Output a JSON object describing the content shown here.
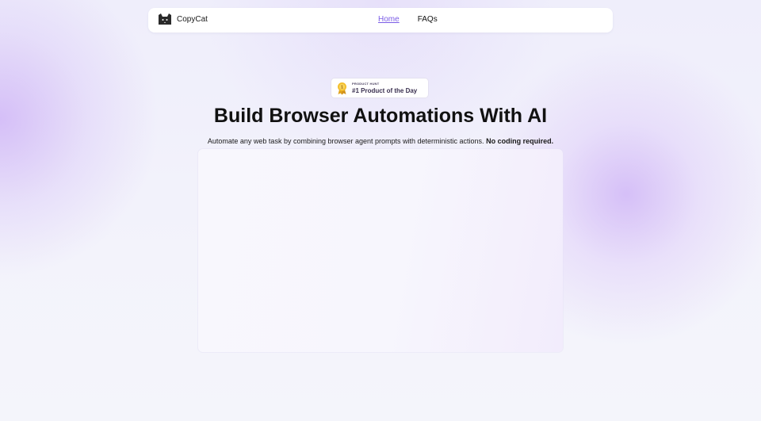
{
  "nav": {
    "brand": "CopyCat",
    "logo_icon": "cat-icon",
    "links": [
      {
        "label": "Home",
        "active": true
      },
      {
        "label": "FAQs",
        "active": false
      }
    ],
    "active_color": "#7b5ce6"
  },
  "badge": {
    "icon": "medal-icon",
    "small_text": "PRODUCT HUNT",
    "main_text": "#1 Product of the Day"
  },
  "hero": {
    "title": "Build Browser Automations With AI",
    "subtitle": "Automate any web task by combining browser agent prompts with deterministic actions.",
    "subtitle_bold": "No coding required."
  },
  "colors": {
    "background": "#f1f1fb",
    "accent_purple": "#b996f5"
  }
}
